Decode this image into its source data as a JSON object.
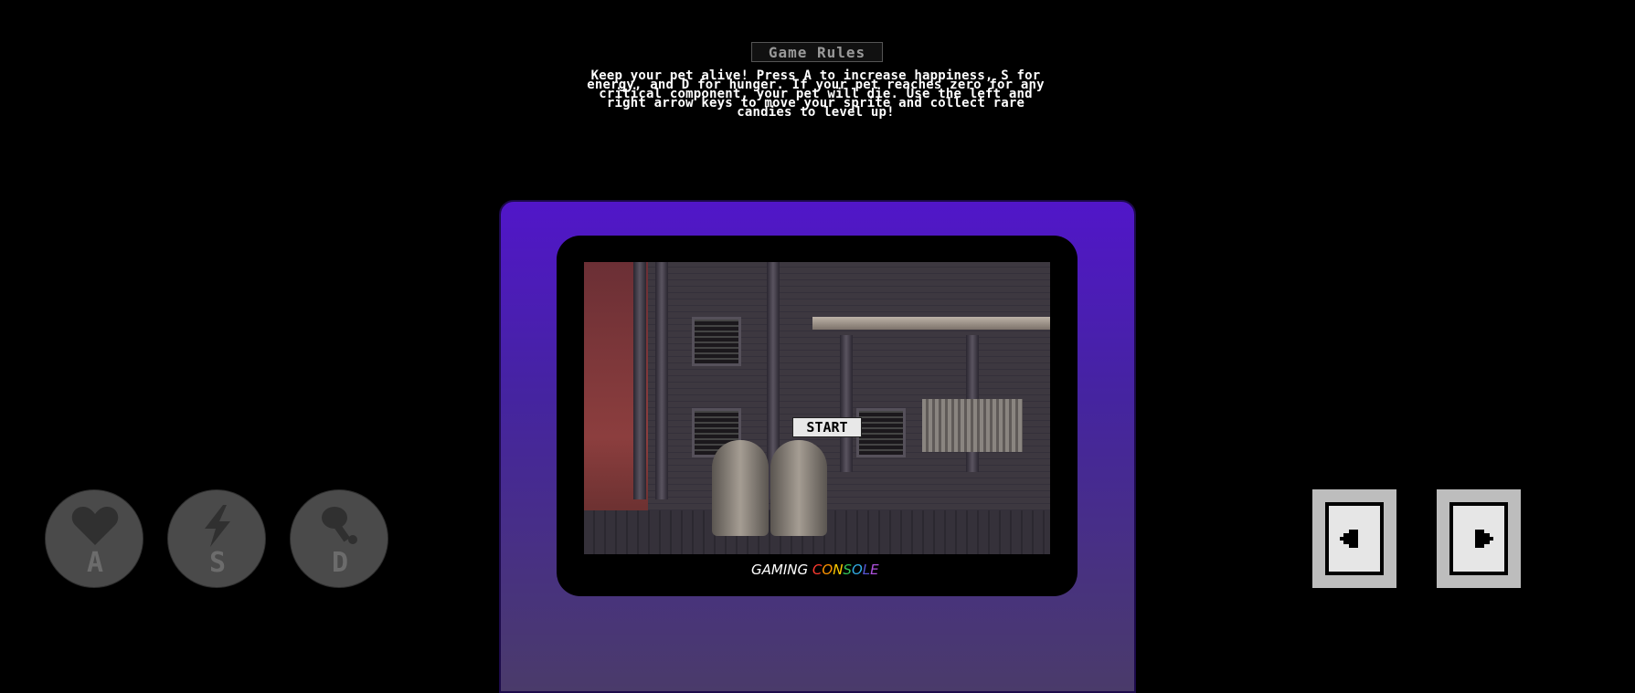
{
  "rules": {
    "title": "Game Rules",
    "text": "Keep your pet alive! Press A to increase happiness, S for energy, and D for hunger. If your pet reaches zero for any critical component, your pet will die. Use the left and right arrow keys to move your sprite and collect rare candies to level up!"
  },
  "screen": {
    "start_label": "START"
  },
  "brand": {
    "word1": "GAMING",
    "word2_letters": [
      "C",
      "O",
      "N",
      "S",
      "O",
      "L",
      "E"
    ]
  },
  "controls": {
    "a": {
      "key": "A",
      "icon": "heart-icon"
    },
    "s": {
      "key": "S",
      "icon": "lightning-icon"
    },
    "d": {
      "key": "D",
      "icon": "drumstick-icon"
    },
    "left": {
      "icon": "left-arrow-icon"
    },
    "right": {
      "icon": "right-arrow-icon"
    }
  },
  "colors": {
    "console_top": "#5116c9",
    "console_bottom": "#4a3b6a",
    "brand_letters": [
      "#ff3b30",
      "#ff9500",
      "#ffcc00",
      "#34c759",
      "#32ade6",
      "#5856d6",
      "#af52de"
    ]
  }
}
